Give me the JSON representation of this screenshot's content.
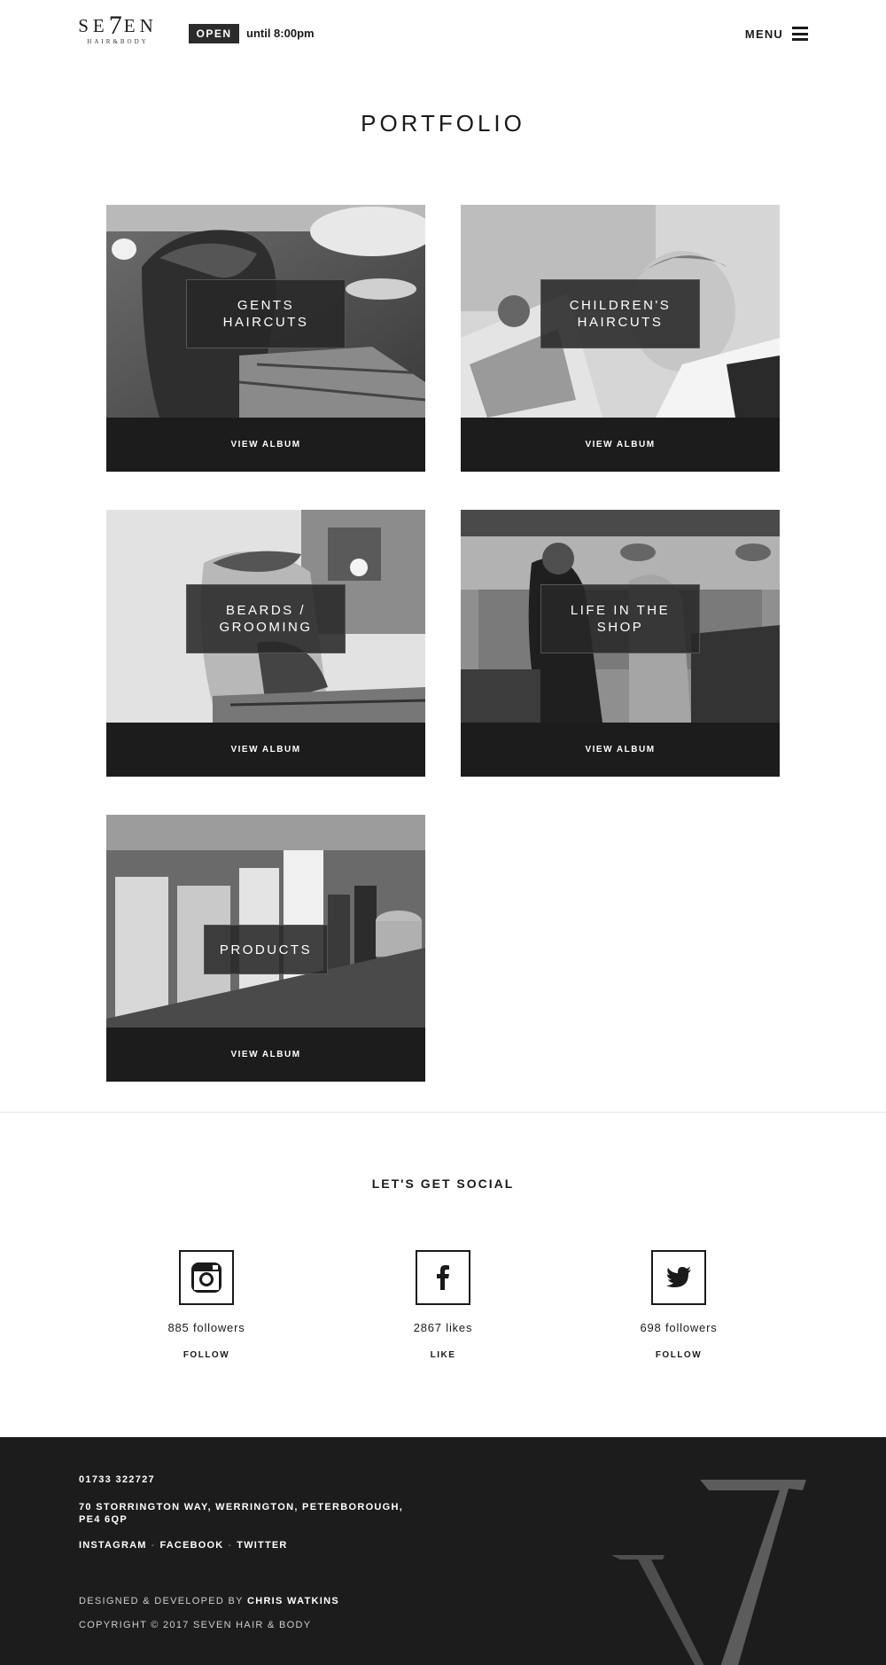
{
  "header": {
    "logo_text": "SEVEN",
    "logo_sub": "HAIR&BODY",
    "open_badge": "OPEN",
    "open_until": "until 8:00pm",
    "menu_label": "MENU"
  },
  "page_title": "PORTFOLIO",
  "albums": [
    {
      "title": "GENTS HAIRCUTS",
      "button": "VIEW ALBUM"
    },
    {
      "title": "CHILDREN'S HAIRCUTS",
      "button": "VIEW ALBUM"
    },
    {
      "title": "BEARDS / GROOMING",
      "button": "VIEW ALBUM"
    },
    {
      "title": "LIFE IN THE SHOP",
      "button": "VIEW ALBUM"
    },
    {
      "title": "PRODUCTS",
      "button": "VIEW ALBUM"
    }
  ],
  "social": {
    "title": "LET'S GET SOCIAL",
    "items": [
      {
        "network": "instagram-icon",
        "count": "885 followers",
        "action": "FOLLOW"
      },
      {
        "network": "facebook-icon",
        "count": "2867 likes",
        "action": "LIKE"
      },
      {
        "network": "twitter-icon",
        "count": "698 followers",
        "action": "FOLLOW"
      }
    ]
  },
  "footer": {
    "phone": "01733 322727",
    "address": "70 STORRINGTON WAY, WERRINGTON, PETERBOROUGH, PE4 6QP",
    "links": [
      "INSTAGRAM",
      "FACEBOOK",
      "TWITTER"
    ],
    "designed_prefix": "DESIGNED & DEVELOPED BY",
    "designed_by": "CHRIS WATKINS",
    "copyright": "COPYRIGHT © 2017 SEVEN HAIR & BODY"
  },
  "colors": {
    "dark": "#1c1c1c",
    "badge": "#2b2b2b",
    "text": "#1a1a1a",
    "white": "#ffffff"
  }
}
